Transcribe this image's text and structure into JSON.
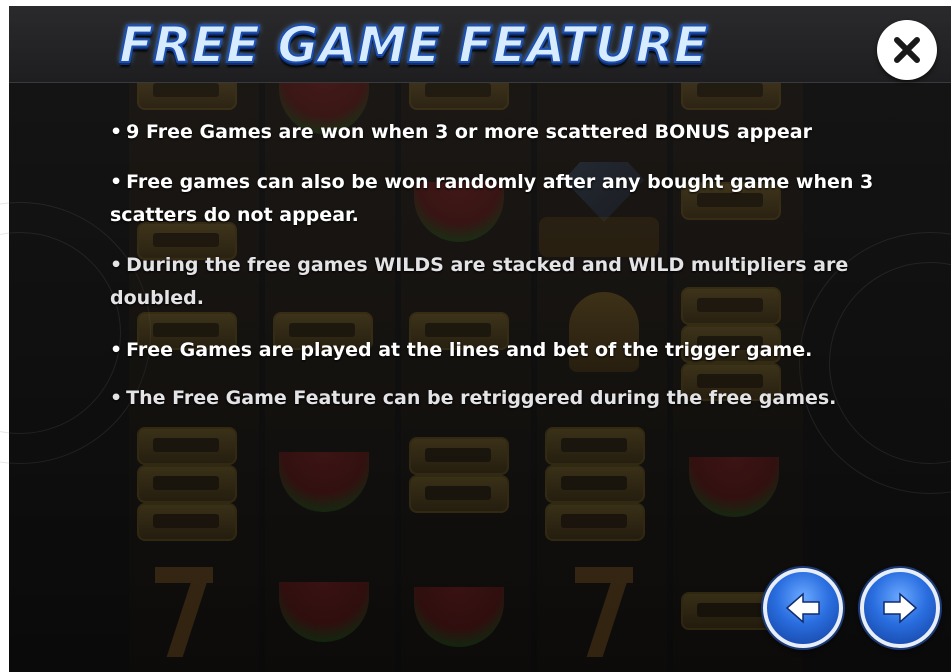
{
  "header": {
    "title": "Free Game Feature",
    "close_icon": "close-icon"
  },
  "rules": [
    {
      "bullet": "•",
      "text": "9 Free Games are won when 3 or more scattered BONUS appear"
    },
    {
      "bullet": "•",
      "text": "Free games can also be won randomly after any bought game when 3 scatters do not appear."
    },
    {
      "bullet": "•",
      "text": "During the free games WILDS are stacked and WILD multipliers are doubled."
    },
    {
      "bullet": "•",
      "text": "Free Games are played at the lines and bet of the trigger game."
    },
    {
      "bullet": "•",
      "text": "The Free Game Feature can be retriggered during the free games."
    }
  ],
  "nav": {
    "prev_icon": "arrow-left-icon",
    "next_icon": "arrow-right-icon"
  },
  "colors": {
    "title_fill": "#d8ecff",
    "title_stroke": "#1c4fb0",
    "nav_button": "#2a6ee0",
    "text": "#ffffff"
  }
}
